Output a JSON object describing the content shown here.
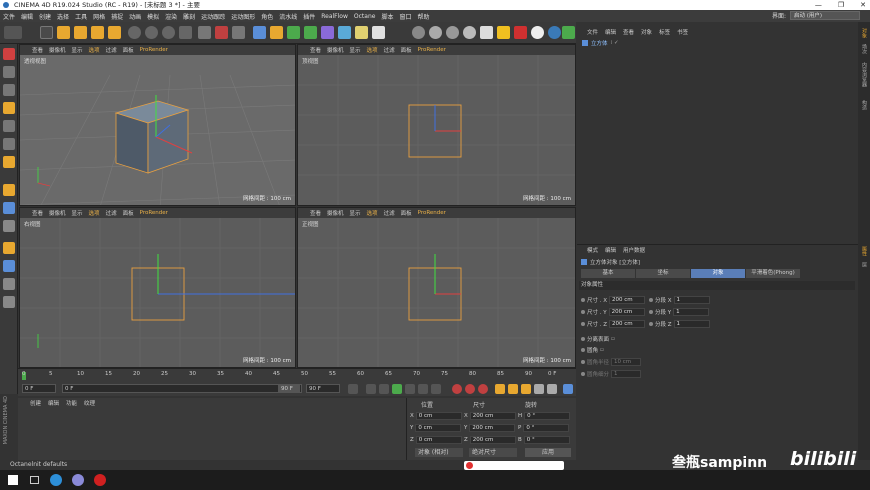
{
  "window": {
    "title": "CINEMA 4D R19.024 Studio (RC - R19) - [未标题 3 *] - 主要",
    "min": "—",
    "max": "❐",
    "close": "✕"
  },
  "menu": {
    "items": [
      "文件",
      "编辑",
      "创建",
      "选择",
      "工具",
      "网格",
      "捕捉",
      "动画",
      "模拟",
      "渲染",
      "雕刻",
      "运动跟踪",
      "运动图形",
      "角色",
      "流水线",
      "插件",
      "RealFlow",
      "Octane",
      "脚本",
      "窗口",
      "帮助"
    ],
    "layout_label": "界面:",
    "layout_value": "启动 (用户)"
  },
  "viewport_menu": [
    "查看",
    "摄像机",
    "显示",
    "选项",
    "过滤",
    "面板"
  ],
  "prorender": "ProRender",
  "viewports": [
    {
      "name": "透视视图",
      "grid": ""
    },
    {
      "name": "顶视图",
      "grid": "网格间距 : 100 cm"
    },
    {
      "name": "右视图",
      "grid": "网格间距 : 100 cm"
    },
    {
      "name": "正视图",
      "grid": "网格间距 : 100 cm"
    }
  ],
  "persp_grid": "网格间距 : 100 cm",
  "object_manager": {
    "menu": [
      "文件",
      "编辑",
      "查看",
      "对象",
      "标签",
      "书签"
    ],
    "object": "立方体"
  },
  "attr_manager": {
    "menu": [
      "模式",
      "编辑",
      "用户数据"
    ],
    "title": "立方体对象 [立方体]",
    "tabs": [
      "基本",
      "坐标",
      "对象",
      "平滑着色(Phong)"
    ],
    "section": "对象属性",
    "size_x": "200 cm",
    "size_y": "200 cm",
    "size_z": "200 cm",
    "seg_x": "1",
    "seg_y": "1",
    "seg_z": "1",
    "size_x_label": "尺寸 . X",
    "size_y_label": "尺寸 . Y",
    "size_z_label": "尺寸 . Z",
    "seg_x_label": "分段 X",
    "seg_y_label": "分段 Y",
    "seg_z_label": "分段 Z",
    "sep_label": "分离表面",
    "fillet_label": "圆角",
    "fillet_r_label": "圆角半径",
    "fillet_r": "10 cm",
    "fillet_s_label": "圆角细分",
    "fillet_s": "1"
  },
  "side_tabs": [
    "对象",
    "场次",
    "内容浏览器",
    "构造"
  ],
  "side_tabs2": [
    "属性",
    "层"
  ],
  "timeline": {
    "ticks": [
      "0",
      "5",
      "10",
      "15",
      "20",
      "25",
      "30",
      "35",
      "40",
      "45",
      "50",
      "55",
      "60",
      "65",
      "70",
      "75",
      "80",
      "85",
      "90"
    ],
    "end_label": "0 F"
  },
  "transport": {
    "start": "0 F",
    "cur": "0 F",
    "end": "90 F",
    "end2": "90 F"
  },
  "material_menu": [
    "创建",
    "编辑",
    "功能",
    "纹理"
  ],
  "coords": {
    "h_pos": "位置",
    "h_size": "尺寸",
    "h_rot": "旋转",
    "x": "0 cm",
    "y": "0 cm",
    "z": "0 cm",
    "sx": "200 cm",
    "sy": "200 cm",
    "sz": "200 cm",
    "h": "0 °",
    "p": "0 °",
    "b": "0 °",
    "mode1": "对象 (相对)",
    "mode2": "绝对尺寸",
    "apply": "应用"
  },
  "status": "Octanelnit defaults",
  "watermark": "叁瓶sampinn",
  "watermark2": "bilibili",
  "maxon": "MAXON CINEMA 4D"
}
